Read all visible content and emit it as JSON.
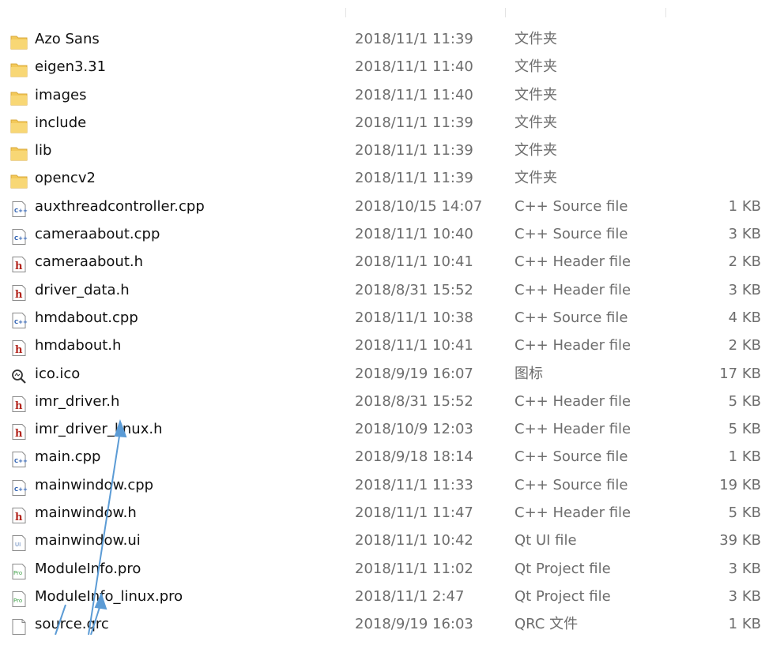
{
  "files": [
    {
      "icon": "folder-icon",
      "name": "Azo Sans",
      "date": "2018/11/1 11:39",
      "type": "文件夹",
      "size": ""
    },
    {
      "icon": "folder-icon",
      "name": "eigen3.31",
      "date": "2018/11/1 11:40",
      "type": "文件夹",
      "size": ""
    },
    {
      "icon": "folder-icon",
      "name": "images",
      "date": "2018/11/1 11:40",
      "type": "文件夹",
      "size": ""
    },
    {
      "icon": "folder-icon",
      "name": "include",
      "date": "2018/11/1 11:39",
      "type": "文件夹",
      "size": ""
    },
    {
      "icon": "folder-icon",
      "name": "lib",
      "date": "2018/11/1 11:39",
      "type": "文件夹",
      "size": ""
    },
    {
      "icon": "folder-icon",
      "name": "opencv2",
      "date": "2018/11/1 11:39",
      "type": "文件夹",
      "size": ""
    },
    {
      "icon": "cpp-file-icon",
      "name": "auxthreadcontroller.cpp",
      "date": "2018/10/15 14:07",
      "type": "C++ Source file",
      "size": "1 KB"
    },
    {
      "icon": "cpp-file-icon",
      "name": "cameraabout.cpp",
      "date": "2018/11/1 10:40",
      "type": "C++ Source file",
      "size": "3 KB"
    },
    {
      "icon": "header-file-icon",
      "name": "cameraabout.h",
      "date": "2018/11/1 10:41",
      "type": "C++ Header file",
      "size": "2 KB"
    },
    {
      "icon": "header-file-icon",
      "name": "driver_data.h",
      "date": "2018/8/31 15:52",
      "type": "C++ Header file",
      "size": "3 KB"
    },
    {
      "icon": "cpp-file-icon",
      "name": "hmdabout.cpp",
      "date": "2018/11/1 10:38",
      "type": "C++ Source file",
      "size": "4 KB"
    },
    {
      "icon": "header-file-icon",
      "name": "hmdabout.h",
      "date": "2018/11/1 10:41",
      "type": "C++ Header file",
      "size": "2 KB"
    },
    {
      "icon": "ico-file-icon",
      "name": "ico.ico",
      "date": "2018/9/19 16:07",
      "type": "图标",
      "size": "17 KB"
    },
    {
      "icon": "header-file-icon",
      "name": "imr_driver.h",
      "date": "2018/8/31 15:52",
      "type": "C++ Header file",
      "size": "5 KB"
    },
    {
      "icon": "header-file-icon",
      "name": "imr_driver_linux.h",
      "date": "2018/10/9 12:03",
      "type": "C++ Header file",
      "size": "5 KB"
    },
    {
      "icon": "cpp-file-icon",
      "name": "main.cpp",
      "date": "2018/9/18 18:14",
      "type": "C++ Source file",
      "size": "1 KB"
    },
    {
      "icon": "cpp-file-icon",
      "name": "mainwindow.cpp",
      "date": "2018/11/1 11:33",
      "type": "C++ Source file",
      "size": "19 KB"
    },
    {
      "icon": "header-file-icon",
      "name": "mainwindow.h",
      "date": "2018/11/1 11:47",
      "type": "C++ Header file",
      "size": "5 KB"
    },
    {
      "icon": "ui-file-icon",
      "name": "mainwindow.ui",
      "date": "2018/11/1 10:42",
      "type": "Qt UI file",
      "size": "39 KB"
    },
    {
      "icon": "pro-file-icon",
      "name": "ModuleInfo.pro",
      "date": "2018/11/1 11:02",
      "type": "Qt Project file",
      "size": "3 KB"
    },
    {
      "icon": "pro-file-icon",
      "name": "ModuleInfo_linux.pro",
      "date": "2018/11/1 2:47",
      "type": "Qt Project file",
      "size": "3 KB"
    },
    {
      "icon": "qrc-file-icon",
      "name": "source.qrc",
      "date": "2018/9/19 16:03",
      "type": "QRC 文件",
      "size": "1 KB"
    }
  ],
  "colors": {
    "folder": "#f3c95a",
    "header_h": "#b3261e",
    "cpp_text": "#2a5db0",
    "arrow": "#5b9bd5",
    "meta_text": "#6d6d6d"
  }
}
